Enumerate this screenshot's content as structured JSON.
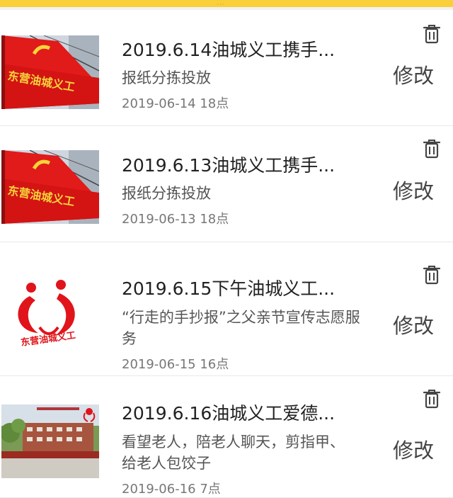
{
  "top_bar": {
    "grip_glyph": "···",
    "color": "#f9cf3a"
  },
  "items": [
    {
      "title": "2019.6.14油城义工携手...",
      "description": "报纸分拣投放",
      "date": "2019-06-14 18点",
      "edit_label": "修改",
      "thumbnail": "red-flag",
      "flag_text": "东营油城义工"
    },
    {
      "title": "2019.6.13油城义工携手...",
      "description": "报纸分拣投放",
      "date": "2019-06-13 18点",
      "edit_label": "修改",
      "thumbnail": "red-flag",
      "flag_text": "东营油城义工"
    },
    {
      "title": "2019.6.15下午油城义工...",
      "description": "“行走的手抄报”之父亲节宣传志愿服务",
      "date": "2019-06-15 16点",
      "edit_label": "修改",
      "thumbnail": "logo",
      "logo_text": "东营油城义工"
    },
    {
      "title": "2019.6.16油城义工爱德...",
      "description": "看望老人，陪老人聊天，剪指甲、给老人包饺子",
      "date": "2019-06-16 7点",
      "edit_label": "修改",
      "thumbnail": "building-photo"
    }
  ],
  "icons": {
    "delete": "trash-icon"
  }
}
